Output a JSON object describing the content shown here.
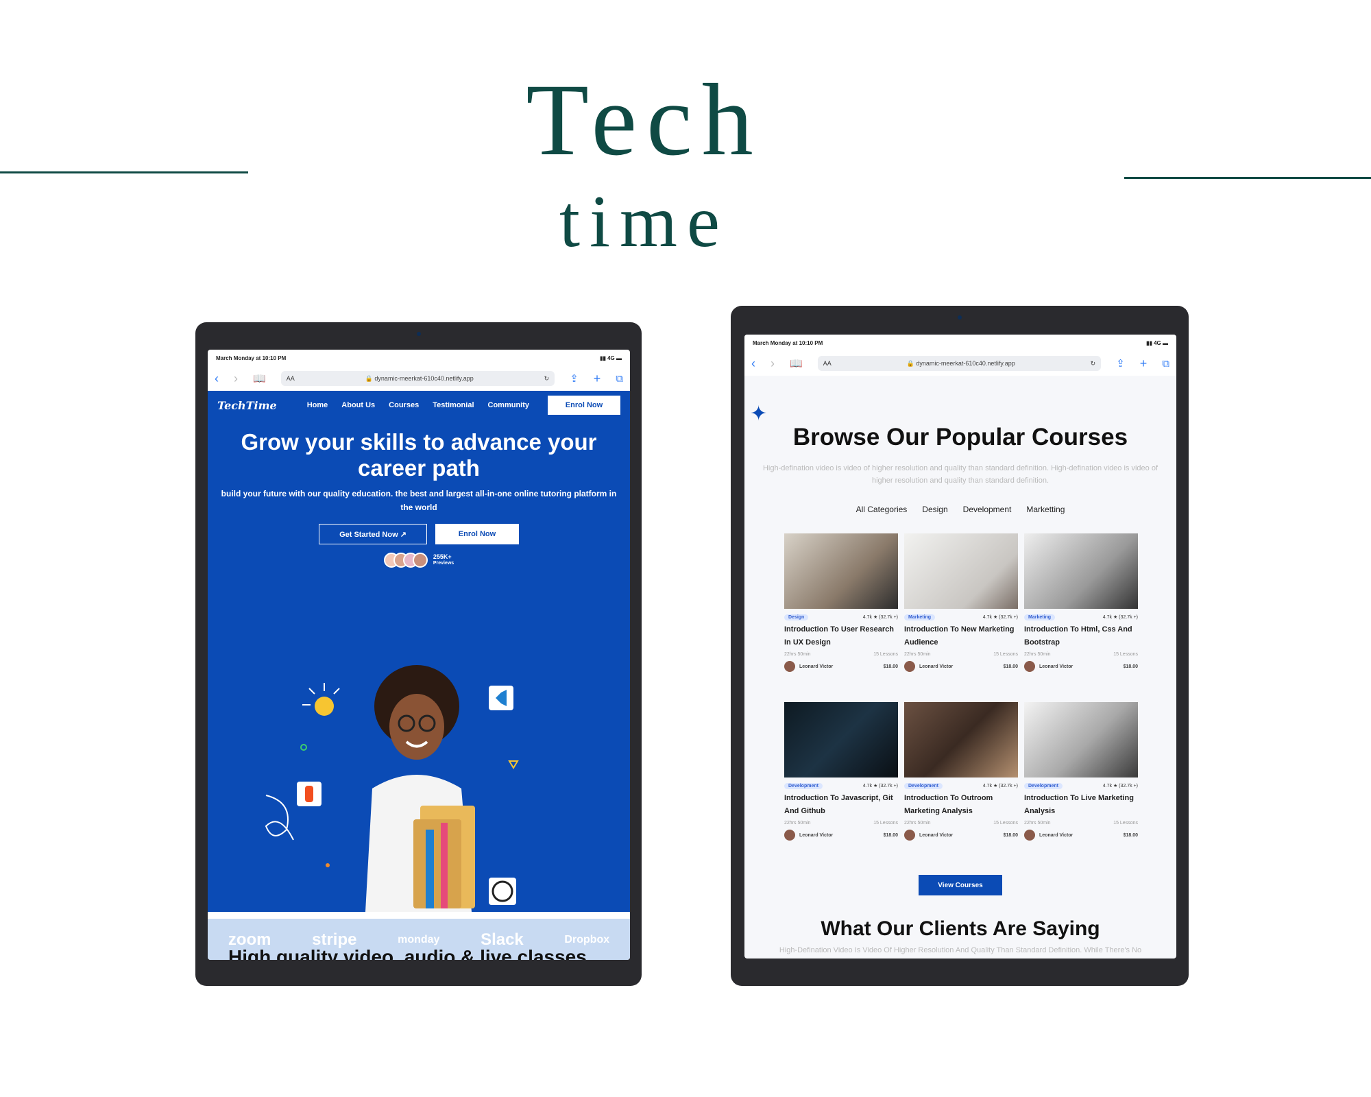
{
  "poster": {
    "title_line1": "Tech",
    "title_line2": "time"
  },
  "browser": {
    "status_time": "March Monday at 10:10 PM",
    "status_signal": "▮▮ 4G ▬",
    "aa": "AA",
    "url": "dynamic-meerkat-610c40.netlify.app"
  },
  "left": {
    "logo": "TechTime",
    "nav": [
      "Home",
      "About Us",
      "Courses",
      "Testimonial",
      "Community"
    ],
    "nav_cta": "Enrol Now",
    "hero_title": "Grow your skills to advance your career path",
    "hero_sub": "build your future with our quality education. the best and largest all-in-one online tutoring platform in the world",
    "btn_started": "Get Started Now ↗",
    "btn_enrol": "Enrol Now",
    "previews_count": "255K+",
    "previews_label": "Previews",
    "partners": [
      "zoom",
      "stripe",
      "monday",
      "Slack",
      "Dropbox"
    ],
    "next_heading": "High quality video, audio & live classes"
  },
  "right": {
    "heading": "Browse Our Popular Courses",
    "sub": "High-defination video is video of higher resolution and quality than standard definition. High-defination video is video of higher resolution and quality than standard definition.",
    "tabs": [
      "All Categories",
      "Design",
      "Development",
      "Marketting"
    ],
    "courses": [
      {
        "tag": "Design",
        "rating": "4.7k ★ (32.7k +)",
        "title": "Introduction To User Research In UX Design",
        "duration": "22hrs 50min",
        "lessons": "15 Lessons",
        "author": "Leonard Victor",
        "price": "$18.00"
      },
      {
        "tag": "Marketing",
        "rating": "4.7k ★ (32.7k +)",
        "title": "Introduction To New Marketing Audience",
        "duration": "22hrs 50min",
        "lessons": "15 Lessons",
        "author": "Leonard Victor",
        "price": "$18.00"
      },
      {
        "tag": "Marketing",
        "rating": "4.7k ★ (32.7k +)",
        "title": "Introduction To Html, Css And Bootstrap",
        "duration": "22hrs 50min",
        "lessons": "15 Lessons",
        "author": "Leonard Victor",
        "price": "$18.00"
      },
      {
        "tag": "Development",
        "rating": "4.7k ★ (32.7k +)",
        "title": "Introduction To Javascript, Git And Github",
        "duration": "22hrs 50min",
        "lessons": "15 Lessons",
        "author": "Leonard Victor",
        "price": "$18.00"
      },
      {
        "tag": "Development",
        "rating": "4.7k ★ (32.7k +)",
        "title": "Introduction To Outroom Marketing Analysis",
        "duration": "22hrs 50min",
        "lessons": "15 Lessons",
        "author": "Leonard Victor",
        "price": "$18.00"
      },
      {
        "tag": "Development",
        "rating": "4.7k ★ (32.7k +)",
        "title": "Introduction To Live Marketing Analysis",
        "duration": "22hrs 50min",
        "lessons": "15 Lessons",
        "author": "Leonard Victor",
        "price": "$18.00"
      }
    ],
    "view_btn": "View Courses",
    "testimonial_heading": "What Our Clients Are Saying",
    "testimonial_sub": "High-Defination Video Is Video Of Higher Resolution And Quality Than Standard Definition. While There's No"
  },
  "colors": {
    "brand": "#0b4bb5",
    "title": "#0f4a44"
  }
}
